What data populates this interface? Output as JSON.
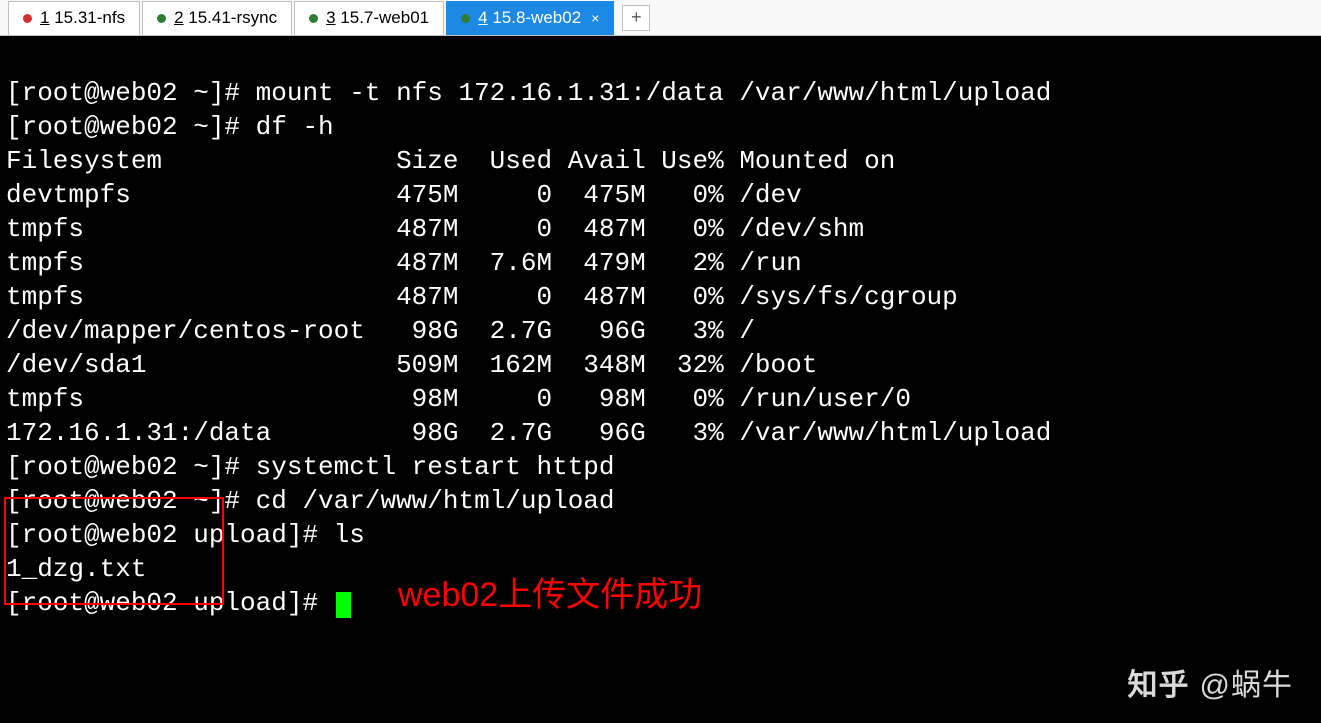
{
  "tabs": [
    {
      "num": "1",
      "label": "15.31-nfs",
      "dot": "red"
    },
    {
      "num": "2",
      "label": "15.41-rsync",
      "dot": "green"
    },
    {
      "num": "3",
      "label": "15.7-web01",
      "dot": "green"
    },
    {
      "num": "4",
      "label": "15.8-web02",
      "dot": "green",
      "active": true
    }
  ],
  "prompt_home": "[root@web02 ~]# ",
  "prompt_upload": "[root@web02 upload]# ",
  "cmd_mount": "mount -t nfs 172.16.1.31:/data /var/www/html/upload",
  "cmd_df": "df -h",
  "df_header": "Filesystem               Size  Used Avail Use% Mounted on",
  "df_rows": [
    "devtmpfs                 475M     0  475M   0% /dev",
    "tmpfs                    487M     0  487M   0% /dev/shm",
    "tmpfs                    487M  7.6M  479M   2% /run",
    "tmpfs                    487M     0  487M   0% /sys/fs/cgroup",
    "/dev/mapper/centos-root   98G  2.7G   96G   3% /",
    "/dev/sda1                509M  162M  348M  32% /boot",
    "tmpfs                     98M     0   98M   0% /run/user/0",
    "172.16.1.31:/data         98G  2.7G   96G   3% /var/www/html/upload"
  ],
  "cmd_restart": "systemctl restart httpd",
  "cmd_cd": "cd /var/www/html/upload",
  "cmd_ls": "ls",
  "ls_output": "1_dzg.txt",
  "annotation": "web02上传文件成功",
  "watermark_logo": "知乎",
  "watermark_text": "@蜗牛",
  "chart_data": {
    "type": "table",
    "title": "df -h output",
    "columns": [
      "Filesystem",
      "Size",
      "Used",
      "Avail",
      "Use%",
      "Mounted on"
    ],
    "rows": [
      [
        "devtmpfs",
        "475M",
        "0",
        "475M",
        "0%",
        "/dev"
      ],
      [
        "tmpfs",
        "487M",
        "0",
        "487M",
        "0%",
        "/dev/shm"
      ],
      [
        "tmpfs",
        "487M",
        "7.6M",
        "479M",
        "2%",
        "/run"
      ],
      [
        "tmpfs",
        "487M",
        "0",
        "487M",
        "0%",
        "/sys/fs/cgroup"
      ],
      [
        "/dev/mapper/centos-root",
        "98G",
        "2.7G",
        "96G",
        "3%",
        "/"
      ],
      [
        "/dev/sda1",
        "509M",
        "162M",
        "348M",
        "32%",
        "/boot"
      ],
      [
        "tmpfs",
        "98M",
        "0",
        "98M",
        "0%",
        "/run/user/0"
      ],
      [
        "172.16.1.31:/data",
        "98G",
        "2.7G",
        "96G",
        "3%",
        "/var/www/html/upload"
      ]
    ]
  }
}
